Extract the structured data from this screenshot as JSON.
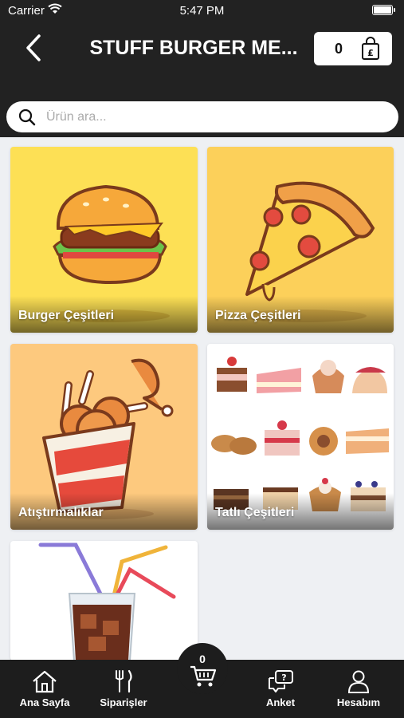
{
  "status_bar": {
    "carrier": "Carrier",
    "time": "5:47 PM"
  },
  "header": {
    "title": "STUFF BURGER ME...",
    "cart_count": "0"
  },
  "search": {
    "placeholder": "Ürün ara..."
  },
  "categories": [
    {
      "label": "Burger Çeşitleri",
      "icon": "burger-illustration",
      "bg": "#fde055"
    },
    {
      "label": "Pizza Çeşitleri",
      "icon": "pizza-illustration",
      "bg": "#fcd05a"
    },
    {
      "label": "Atıştırmalıklar",
      "icon": "fried-chicken-illustration",
      "bg": "#fdc97e"
    },
    {
      "label": "Tatlı Çeşitleri",
      "icon": "desserts-illustration",
      "bg": "#ffffff"
    },
    {
      "label": "",
      "icon": "cola-drink-illustration",
      "bg": "#ffffff"
    }
  ],
  "bottom_nav": {
    "items": [
      {
        "label": "Ana Sayfa",
        "icon": "home-icon"
      },
      {
        "label": "Siparişler",
        "icon": "cutlery-icon"
      },
      {
        "label": "Anket",
        "icon": "survey-chat-icon"
      },
      {
        "label": "Hesabım",
        "icon": "user-icon"
      }
    ],
    "cart_count": "0"
  },
  "colors": {
    "header_bg": "#222222",
    "page_bg": "#eef0f3",
    "nav_bg": "#1d1d1d"
  }
}
